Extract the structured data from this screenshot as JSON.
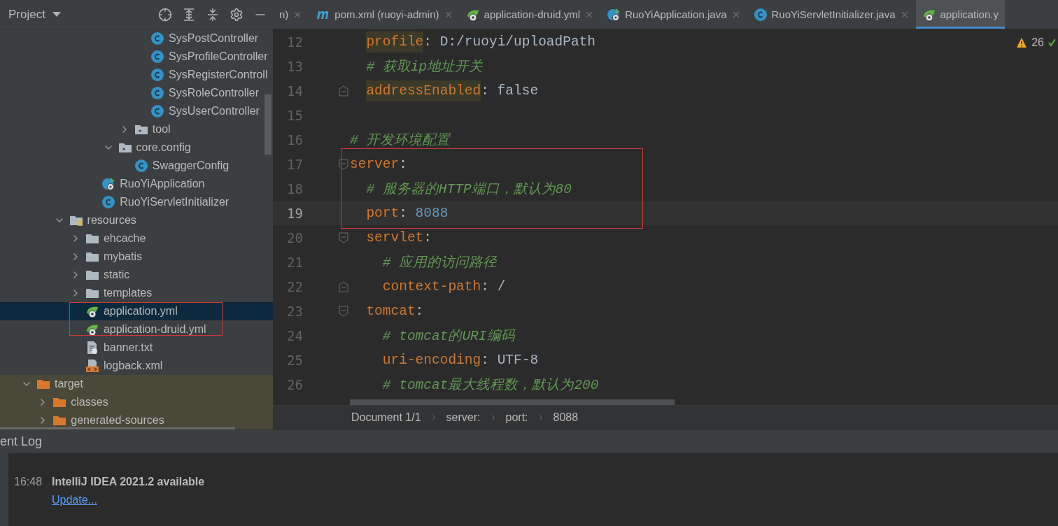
{
  "project_panel": {
    "title": "Project"
  },
  "tree": {
    "items": [
      {
        "children": [
          {
            "children": [
              {
                "children": [
                  {
                    "children": [
                      {
                        "children": [
                          {
                            "children": [
                              {
                                "children": [
                                  {
                                    "label": "SysPostController",
                                    "kind": "class",
                                    "selected": false,
                                    "excluded": false
                                  },
                                  {
                                    "label": "SysProfileController",
                                    "kind": "class",
                                    "selected": false,
                                    "excluded": false
                                  },
                                  {
                                    "label": "SysRegisterControll",
                                    "kind": "class",
                                    "selected": false,
                                    "excluded": false
                                  },
                                  {
                                    "label": "SysRoleController",
                                    "kind": "class",
                                    "selected": false,
                                    "excluded": false
                                  },
                                  {
                                    "label": "SysUserController",
                                    "kind": "class",
                                    "selected": false,
                                    "excluded": false
                                  }
                                ]
                              },
                              {
                                "label": "tool",
                                "kind": "package",
                                "selected": false,
                                "excluded": false,
                                "expanded": false
                              }
                            ]
                          },
                          {
                            "label": "core.config",
                            "kind": "package",
                            "selected": false,
                            "excluded": false,
                            "expanded": true,
                            "children": [
                              {
                                "label": "SwaggerConfig",
                                "kind": "class",
                                "selected": false,
                                "excluded": false
                              }
                            ]
                          }
                        ]
                      },
                      {
                        "label": "RuoYiApplication",
                        "kind": "spring-class",
                        "selected": false,
                        "excluded": false
                      },
                      {
                        "label": "RuoYiServletInitializer",
                        "kind": "class",
                        "selected": false,
                        "excluded": false
                      }
                    ]
                  }
                ]
              },
              {
                "label": "resources",
                "kind": "resources",
                "selected": false,
                "excluded": false,
                "expanded": true,
                "children": [
                  {
                    "label": "ehcache",
                    "kind": "folder",
                    "selected": false,
                    "excluded": false,
                    "expanded": false
                  },
                  {
                    "label": "mybatis",
                    "kind": "folder",
                    "selected": false,
                    "excluded": false,
                    "expanded": false
                  },
                  {
                    "label": "static",
                    "kind": "folder",
                    "selected": false,
                    "excluded": false,
                    "expanded": false
                  },
                  {
                    "label": "templates",
                    "kind": "folder",
                    "selected": false,
                    "excluded": false,
                    "expanded": false
                  },
                  {
                    "label": "application.yml",
                    "kind": "spring-config",
                    "selected": true,
                    "excluded": false
                  },
                  {
                    "label": "application-druid.yml",
                    "kind": "spring-config",
                    "selected": false,
                    "excluded": false
                  },
                  {
                    "label": "banner.txt",
                    "kind": "text-file",
                    "selected": false,
                    "excluded": false
                  },
                  {
                    "label": "logback.xml",
                    "kind": "xml-file",
                    "selected": false,
                    "excluded": false
                  }
                ]
              }
            ]
          }
        ]
      },
      {
        "label": "target",
        "kind": "excluded-folder",
        "selected": false,
        "excluded": true,
        "expanded": true,
        "children": [
          {
            "label": "classes",
            "kind": "excluded-folder",
            "selected": false,
            "excluded": true,
            "expanded": false
          },
          {
            "label": "generated-sources",
            "kind": "excluded-folder",
            "selected": false,
            "excluded": true,
            "expanded": false
          }
        ]
      }
    ]
  },
  "tabs": [
    {
      "label": "n)",
      "kind": "none",
      "selected": false
    },
    {
      "label": "pom.xml (ruoyi-admin)",
      "kind": "maven",
      "selected": false
    },
    {
      "label": "application-druid.yml",
      "kind": "spring-config",
      "selected": false
    },
    {
      "label": "RuoYiApplication.java",
      "kind": "spring-class",
      "selected": false
    },
    {
      "label": "RuoYiServletInitializer.java",
      "kind": "class",
      "selected": false
    },
    {
      "label": "application.y",
      "kind": "spring-config",
      "selected": true
    }
  ],
  "editor": {
    "warnings": "26",
    "lines": [
      {
        "children": [
          {
            "number": "12",
            "current": false,
            "fold_end": false,
            "tokens": [
              {
                "kind": "key",
                "text": "profile",
                "highlighted": true
              },
              {
                "kind": "plain",
                "text": ": D:/ruoyi/uploadPath"
              }
            ]
          },
          {
            "number": "13",
            "current": false,
            "fold_end": false,
            "tokens": [
              {
                "kind": "comment",
                "text": "# 获取ip地址开关"
              }
            ]
          },
          {
            "number": "14",
            "current": false,
            "fold_end": true,
            "tokens": [
              {
                "kind": "key",
                "text": "addressEnabled",
                "highlighted": true
              },
              {
                "kind": "plain",
                "text": ": false"
              }
            ]
          }
        ]
      },
      {
        "number": "15",
        "current": false,
        "fold_end": false
      },
      {
        "number": "16",
        "current": false,
        "fold_end": false,
        "tokens": [
          {
            "kind": "comment",
            "text": "# 开发环境配置"
          }
        ]
      },
      {
        "number": "17",
        "current": false,
        "expanded": true,
        "tokens": [
          {
            "kind": "key",
            "text": "server",
            "highlighted": false
          },
          {
            "kind": "plain",
            "text": ":"
          }
        ],
        "children": [
          {
            "number": "18",
            "current": false,
            "fold_end": false,
            "tokens": [
              {
                "kind": "comment",
                "text": "# 服务器的HTTP端口，默认为80"
              }
            ]
          },
          {
            "number": "19",
            "current": true,
            "fold_end": false,
            "tokens": [
              {
                "kind": "key",
                "text": "port",
                "highlighted": false
              },
              {
                "kind": "plain",
                "text": ": "
              },
              {
                "kind": "number",
                "text": "8088"
              }
            ]
          },
          {
            "number": "20",
            "current": false,
            "expanded": true,
            "tokens": [
              {
                "kind": "key",
                "text": "servlet",
                "highlighted": false
              },
              {
                "kind": "plain",
                "text": ":"
              }
            ],
            "children": [
              {
                "number": "21",
                "current": false,
                "fold_end": false,
                "tokens": [
                  {
                    "kind": "comment",
                    "text": "# 应用的访问路径"
                  }
                ]
              },
              {
                "number": "22",
                "current": false,
                "fold_end": true,
                "tokens": [
                  {
                    "kind": "key",
                    "text": "context-path",
                    "highlighted": false
                  },
                  {
                    "kind": "plain",
                    "text": ": /"
                  }
                ]
              }
            ]
          },
          {
            "number": "23",
            "current": false,
            "expanded": true,
            "tokens": [
              {
                "kind": "key",
                "text": "tomcat",
                "highlighted": false
              },
              {
                "kind": "plain",
                "text": ":"
              }
            ],
            "children": [
              {
                "number": "24",
                "current": false,
                "fold_end": false,
                "tokens": [
                  {
                    "kind": "comment",
                    "text": "# tomcat的URI编码"
                  }
                ]
              },
              {
                "number": "25",
                "current": false,
                "fold_end": false,
                "tokens": [
                  {
                    "kind": "key",
                    "text": "uri-encoding",
                    "highlighted": false
                  },
                  {
                    "kind": "plain",
                    "text": ": UTF-8"
                  }
                ]
              },
              {
                "number": "26",
                "current": false,
                "fold_end": false,
                "tokens": [
                  {
                    "kind": "comment",
                    "text": "# tomcat最大线程数，默认为200"
                  }
                ]
              }
            ]
          }
        ]
      }
    ]
  },
  "breadcrumbs": [
    "Document 1/1",
    "server:",
    "port:",
    "8088"
  ],
  "event_log": {
    "title": "ent Log",
    "entries": [
      {
        "time": "16:48",
        "message": "IntelliJ IDEA 2021.2 available",
        "link": "Update..."
      }
    ]
  }
}
